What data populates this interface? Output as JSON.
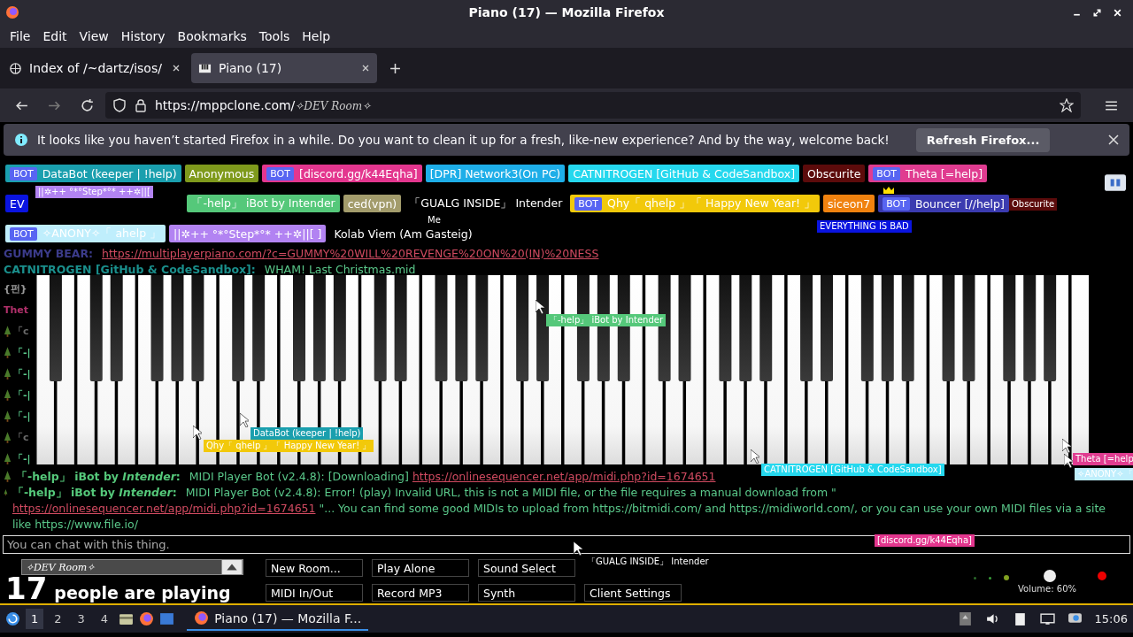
{
  "window": {
    "title": "Piano (17) — Mozilla Firefox"
  },
  "menu": [
    "File",
    "Edit",
    "View",
    "History",
    "Bookmarks",
    "Tools",
    "Help"
  ],
  "tabs": [
    {
      "label": "Index of /~dartz/isos/",
      "selected": false
    },
    {
      "label": "Piano (17)",
      "selected": true
    }
  ],
  "address": {
    "url": "https://mppclone.com/",
    "path": "✧DEV Room✧"
  },
  "notification": {
    "text": "It looks like you haven’t started Firefox in a while. Do you want to clean it up for a fresh, like-new experience? And by the way, welcome back!",
    "button": "Refresh Firefox..."
  },
  "users": [
    {
      "name": "DataBot (keeper | !help)",
      "badge": "BOT",
      "color": "#1a9fae"
    },
    {
      "name": "Anonymous",
      "color": "#7f9a1c"
    },
    {
      "name": "[discord.gg/k44Eqha]",
      "badge": "BOT",
      "color": "#e3368e"
    },
    {
      "name": "[DPR] Network3(On PC)",
      "color": "#1eaee8"
    },
    {
      "name": "CATNITROGEN [GitHub & CodeSandbox]",
      "color": "#25d8ee"
    },
    {
      "name": "Obscurite",
      "color": "#5c0b0b"
    },
    {
      "name": "Theta [=help]",
      "badge": "BOT",
      "color": "#e03c90"
    },
    {
      "name": "EV",
      "color": "#0a14e0"
    },
    {
      "name": "「-help」 iBot by Intender",
      "color": "#55c87a"
    },
    {
      "name": "ced(vpn)",
      "color": "#a39c6c"
    },
    {
      "name": "「GUALG INSIDE」 Intender",
      "color": "#000000"
    },
    {
      "name": "Qhy「 qhelp 」「 Happy New Year! 」",
      "badge": "BOT",
      "color": "#f2c90a"
    },
    {
      "name": "siceon7",
      "color": "#f0820f"
    },
    {
      "name": "Bouncer [//help]",
      "badge": "BOT",
      "owner": true,
      "color": "#3b3bb0"
    },
    {
      "name": "✧ANONY✧「 ahelp 」",
      "badge": "BOT",
      "color": "#bfeefc"
    },
    {
      "name": "||✲++ °*°Step*°* ++✲||[ ]",
      "color": "#b283f2"
    },
    {
      "name": "Kolab Viem (Am Gasteig)",
      "color": "#000000"
    }
  ],
  "cursors": [
    {
      "name": "||✲++ °*°Step*°* ++✲||[",
      "color": "#b283f2"
    },
    {
      "name": "Obscurite",
      "color": "#5c0b0b"
    },
    {
      "name": "Me",
      "color": "#000000"
    },
    {
      "name": "EVERYTHING IS BAD",
      "color": "#0a14e0"
    },
    {
      "name": "「-help」 iBot by Intender",
      "color": "#55c87a"
    },
    {
      "name": "DataBot (keeper | !help)",
      "color": "#1a9fae"
    },
    {
      "name": "Qhy「 qhelp 」「 Happy New Year! 」",
      "color": "#f2c90a"
    },
    {
      "name": "CATNITROGEN [GitHub & CodeSandbox]",
      "color": "#25d8ee"
    },
    {
      "name": "Theta [=help",
      "color": "#e03c90"
    },
    {
      "name": "✧ANONY✧「",
      "color": "#bfeefc"
    },
    {
      "name": "[discord.gg/k44Eqha]",
      "color": "#e3368e"
    },
    {
      "name": "「GUALG INSIDE」 Intender",
      "color": "#000000"
    }
  ],
  "chat": [
    {
      "name": "GUMMY BEAR:",
      "color": "#3b3b8a",
      "parts": [
        {
          "kind": "link",
          "text": "https://multiplayerpiano.com/?c=GUMMY%20WILL%20REVENGE%20ON%20(IN)%20NESS"
        }
      ]
    },
    {
      "name": "CATNITROGEN [GitHub & CodeSandbox]:",
      "color": "#1a8f8c",
      "parts": [
        {
          "kind": "text",
          "text": "WHAM! Last Christmas.mid"
        }
      ]
    },
    {
      "name": "{펀}",
      "color": "#9a9a9a"
    },
    {
      "name": "Thet",
      "color": "#b0306a"
    },
    {
      "name": "「c",
      "tree": true,
      "color": "#6a6a6a"
    },
    {
      "name": "「-|",
      "tree": true,
      "color": "#5ac88a"
    },
    {
      "name": "「-|",
      "tree": true,
      "color": "#5ac88a"
    },
    {
      "name": "「-|",
      "tree": true,
      "color": "#5ac88a"
    },
    {
      "name": "「-|",
      "tree": true,
      "color": "#5ac88a"
    },
    {
      "name": "「c",
      "tree": true,
      "color": "#6a6a6a"
    },
    {
      "name": "「-|",
      "tree": true,
      "color": "#5ac88a"
    },
    {
      "name": "「-help」 iBot by *Intender*:",
      "tree": true,
      "color": "#55c87a",
      "parts": [
        {
          "kind": "text",
          "text": "MIDI Player Bot (v2.4.8): [Downloading]"
        },
        {
          "kind": "link",
          "text": "https://onlinesequencer.net/app/midi.php?id=1674651"
        }
      ]
    },
    {
      "name": "「-help」 iBot by *Intender*:",
      "tree": true,
      "color": "#55c87a",
      "parts": [
        {
          "kind": "text",
          "text": "MIDI Player Bot (v2.4.8): Error! (play) Invalid URL, this is not a MIDI file, or the file requires a manual download from \""
        },
        {
          "kind": "link",
          "text": "https://onlinesequencer.net/app/midi.php?id=1674651"
        },
        {
          "kind": "text",
          "text": "\"... You can find some good MIDIs to upload from https://bitmidi.com/ and https://midiworld.com/, or you can use your own MIDI files via a site like https://www.file.io/"
        }
      ]
    }
  ],
  "chat_input": {
    "placeholder": "You can chat with this thing."
  },
  "room": {
    "name": "✧DEV Room✧"
  },
  "people": {
    "count": "17",
    "label": "people are playing"
  },
  "buttons": [
    "New Room...",
    "Play Alone",
    "Sound Select",
    "MIDI In/Out",
    "Record MP3",
    "Synth",
    "Client Settings"
  ],
  "volume": {
    "label": "Volume: 60%"
  },
  "taskbar": {
    "workspaces": [
      {
        "label": "1",
        "selected": true
      },
      {
        "label": "2",
        "selected": false
      },
      {
        "label": "3",
        "selected": false
      },
      {
        "label": "4",
        "selected": false
      }
    ],
    "task": "Piano (17) — Mozilla F...",
    "clock": "15:06"
  }
}
